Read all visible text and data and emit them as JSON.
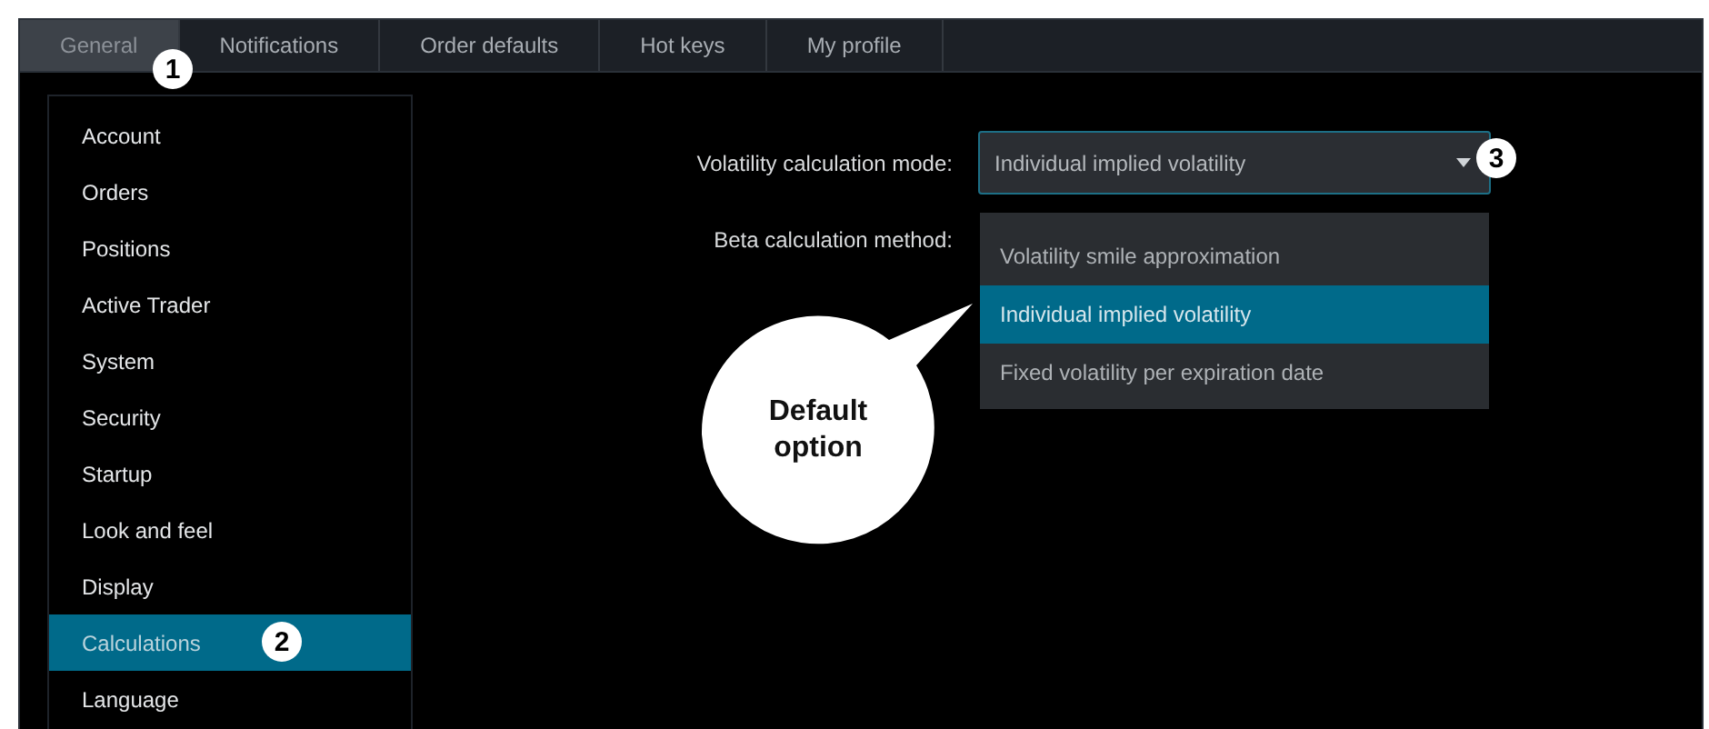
{
  "tabs": [
    {
      "label": "General",
      "selected": true
    },
    {
      "label": "Notifications",
      "selected": false
    },
    {
      "label": "Order defaults",
      "selected": false
    },
    {
      "label": "Hot keys",
      "selected": false
    },
    {
      "label": "My profile",
      "selected": false
    }
  ],
  "sidebar": {
    "items": [
      {
        "label": "Account",
        "selected": false
      },
      {
        "label": "Orders",
        "selected": false
      },
      {
        "label": "Positions",
        "selected": false
      },
      {
        "label": "Active Trader",
        "selected": false
      },
      {
        "label": "System",
        "selected": false
      },
      {
        "label": "Security",
        "selected": false
      },
      {
        "label": "Startup",
        "selected": false
      },
      {
        "label": "Look and feel",
        "selected": false
      },
      {
        "label": "Display",
        "selected": false
      },
      {
        "label": "Calculations",
        "selected": true
      },
      {
        "label": "Language",
        "selected": false
      }
    ]
  },
  "form": {
    "volatility_mode": {
      "label": "Volatility calculation mode:",
      "value": "Individual implied volatility",
      "options": [
        {
          "label": "Volatility smile approximation",
          "selected": false
        },
        {
          "label": "Individual implied volatility",
          "selected": true
        },
        {
          "label": "Fixed volatility per expiration date",
          "selected": false
        }
      ]
    },
    "beta_method": {
      "label": "Beta calculation method:"
    }
  },
  "annotations": {
    "badges": [
      "1",
      "2",
      "3"
    ],
    "callout": "Default option"
  }
}
